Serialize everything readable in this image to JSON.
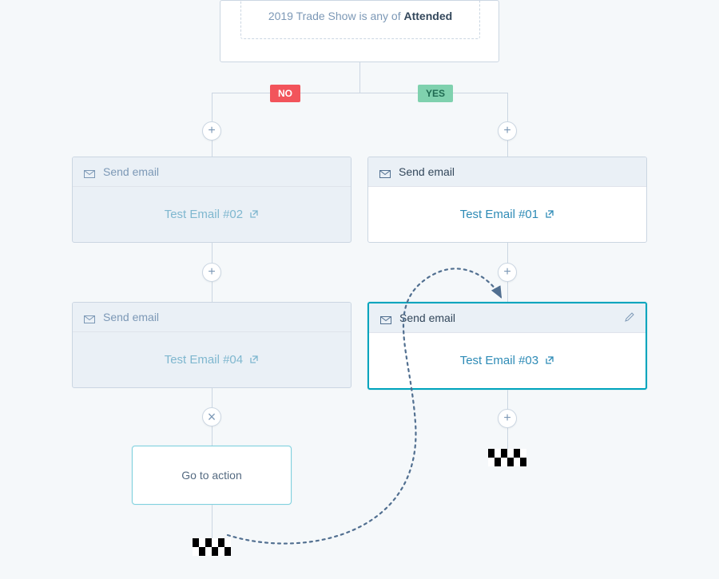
{
  "condition": {
    "field": "2019 Trade Show",
    "operator": "is any of",
    "value": "Attended"
  },
  "branches": {
    "no_label": "NO",
    "yes_label": "YES"
  },
  "cards": {
    "no1": {
      "type": "Send email",
      "link": "Test Email #02"
    },
    "no2": {
      "type": "Send email",
      "link": "Test Email #04"
    },
    "yes1": {
      "type": "Send email",
      "link": "Test Email #01"
    },
    "yes2": {
      "type": "Send email",
      "link": "Test Email #03"
    }
  },
  "goto": {
    "label": "Go to action"
  },
  "icons": {
    "plus": "+",
    "close": "×"
  }
}
